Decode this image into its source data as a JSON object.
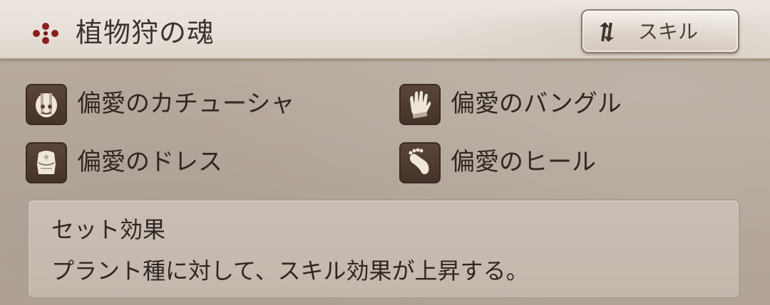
{
  "header": {
    "title": "植物狩の魂",
    "title_icon": "quatrefoil-icon",
    "skill_button": {
      "label": "スキル",
      "icon": "swap-arrows-icon"
    }
  },
  "equipment": [
    {
      "name": "偏愛のカチューシャ",
      "icon": "head-icon"
    },
    {
      "name": "偏愛のバングル",
      "icon": "glove-icon"
    },
    {
      "name": "偏愛のドレス",
      "icon": "dress-icon"
    },
    {
      "name": "偏愛のヒール",
      "icon": "foot-icon"
    }
  ],
  "set_effect": {
    "title": "セット効果",
    "description": "プラント種に対して、スキル効果が上昇する。"
  },
  "colors": {
    "accent": "#8b1e1e",
    "text": "#2f2722",
    "icon_bg": "#4d3a2f"
  }
}
